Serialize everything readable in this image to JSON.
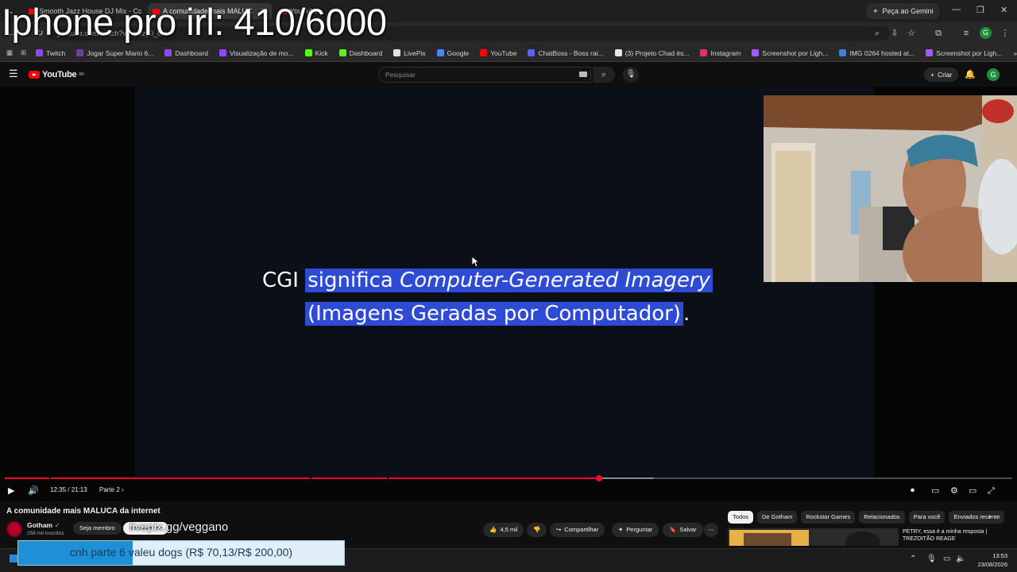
{
  "overlay": {
    "title": "Iphone pro irl: 410/6000"
  },
  "browser": {
    "tabs": [
      {
        "label": "Smooth Jazz House DJ Mix - Cc"
      },
      {
        "label": "A comunidade mais MALUC"
      },
      {
        "label": "YouTube"
      }
    ],
    "gemini_label": "Peça ao Gemini",
    "url": "youtube.com/watch?v=vpnzy0_8mr",
    "profile_initial": "G"
  },
  "bookmarks": [
    {
      "label": "Twitch",
      "color": "#9146ff"
    },
    {
      "label": "Jogar Super Mario 6...",
      "color": "#6b3fa0"
    },
    {
      "label": "Dashboard",
      "color": "#9146ff"
    },
    {
      "label": "Visualização de mo...",
      "color": "#9146ff"
    },
    {
      "label": "Kick",
      "color": "#53fc18"
    },
    {
      "label": "Dashboard",
      "color": "#53fc18"
    },
    {
      "label": "LivePix",
      "color": "#e0e0e0"
    },
    {
      "label": "Google",
      "color": "#4285f4"
    },
    {
      "label": "YouTube",
      "color": "#ff0000"
    },
    {
      "label": "ChatBoss - Boss rai...",
      "color": "#5865f2"
    },
    {
      "label": "(3) Projeto Chad és...",
      "color": "#e7e7e7"
    },
    {
      "label": "Instagram",
      "color": "#e1306c"
    },
    {
      "label": "Screenshot por Ligh...",
      "color": "#a259ff"
    },
    {
      "label": "IMG 0264 hosted at...",
      "color": "#4a7bd0"
    },
    {
      "label": "Screenshot por Ligh...",
      "color": "#a259ff"
    }
  ],
  "youtube": {
    "logo_text": "YouTube",
    "logo_sup": "BR",
    "search_placeholder": "Pesquisar",
    "create_label": "Criar",
    "avatar_initial": "G"
  },
  "caption": {
    "lead": "CGI ",
    "word1": "significa ",
    "italic": "Computer-Generated Imagery",
    "line2": "(Imagens Geradas por Computador)",
    "end": "."
  },
  "player": {
    "time": "12:35 / 21:13",
    "chapter": "Parte 2",
    "progress": 0.59,
    "buffered": 0.644
  },
  "video": {
    "title": "A comunidade mais MALUCA da internet",
    "channel": "Gotham",
    "subscribers": "258 mil inscritos",
    "join_label": "Seja membro",
    "subscribe_label": "Inscrever-se",
    "subscribe_overlay": "livepix.gg/veggano",
    "likes": "4,5 mil",
    "share_label": "Compartilhar",
    "ask_label": "Perguntar",
    "save_label": "Salvar"
  },
  "chips": [
    "Todos",
    "De Gotham",
    "Rockstar Games",
    "Relacionados",
    "Para você",
    "Enviados recente"
  ],
  "recommendation": {
    "title": "PETRY, essa é a minha resposta | TREZOITÃO REAGE"
  },
  "donation": {
    "text": "cnh parte 6 valeu dogs (R$ 70,13/R$ 200,00)",
    "progress": 0.35
  },
  "clock": {
    "time": "13:53",
    "date": "23/08/2026"
  }
}
